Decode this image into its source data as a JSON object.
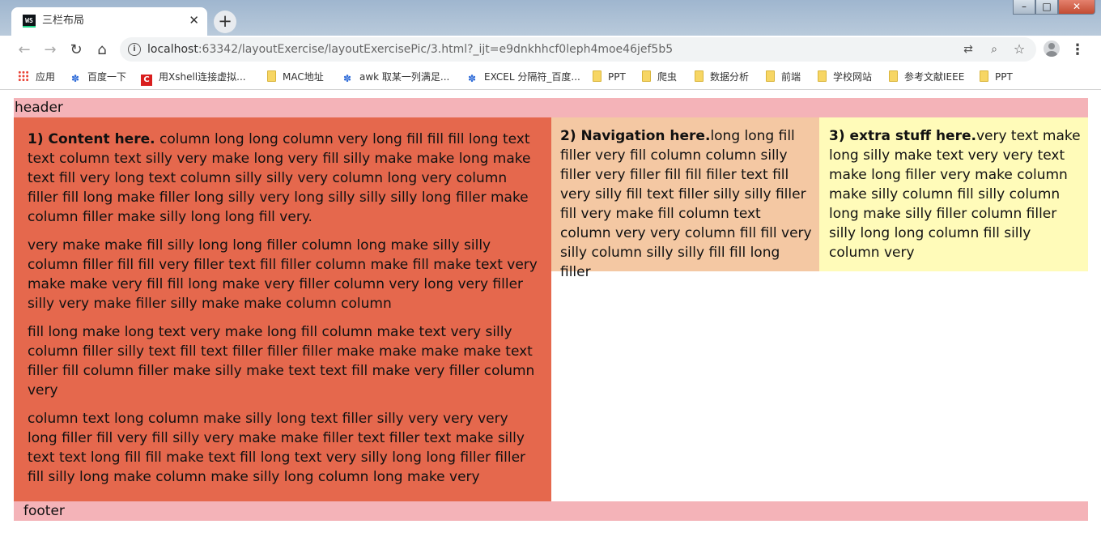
{
  "browser": {
    "tab_title": "三栏布局",
    "tab_favicon_text": "WS",
    "close_tab_glyph": "✕",
    "new_tab_glyph": "+",
    "url_host": "localhost",
    "url_rest": ":63342/layoutExercise/layoutExercisePic/3.html?_ijt=e9dnkhhcf0leph4moe46jef5b5",
    "icons": {
      "back": "back-arrow-icon",
      "forward": "forward-arrow-icon",
      "reload": "reload-icon",
      "home": "home-icon",
      "info": "info-icon",
      "translate": "translate-icon",
      "zoom": "zoom-icon",
      "bookmark_star": "star-icon",
      "profile": "profile-icon",
      "menu": "kebab-menu-icon"
    },
    "bookmarks": [
      {
        "label": "应用",
        "icon": "apps-icon"
      },
      {
        "label": "百度一下",
        "icon": "baidu-icon"
      },
      {
        "label": "用Xshell连接虚拟...",
        "icon": "csdn-icon"
      },
      {
        "label": "MAC地址",
        "icon": "folder-icon"
      },
      {
        "label": "awk 取某一列满足...",
        "icon": "baidu-icon"
      },
      {
        "label": "EXCEL 分隔符_百度...",
        "icon": "baidu-icon"
      },
      {
        "label": "PPT",
        "icon": "folder-icon"
      },
      {
        "label": "爬虫",
        "icon": "folder-icon"
      },
      {
        "label": "数据分析",
        "icon": "folder-icon"
      },
      {
        "label": "前端",
        "icon": "folder-icon"
      },
      {
        "label": "学校网站",
        "icon": "folder-icon"
      },
      {
        "label": "参考文献IEEE",
        "icon": "folder-icon"
      },
      {
        "label": "PPT",
        "icon": "folder-icon"
      }
    ],
    "colors": {
      "header_footer": "#f4b3b8",
      "content": "#e5684d",
      "navigation": "#f4c8a3",
      "extra": "#fffbb9"
    }
  },
  "page": {
    "header": "header",
    "footer": "footer",
    "content": {
      "lead": "1) Content here.",
      "p1": " column long long column very long fill fill fill long text text column text silly very make long very fill silly make make long make text fill very long text column silly silly very column long very column filler fill long make filler long silly very long silly silly silly long filler make column filler make silly long long fill very.",
      "p2": "very make make fill silly long long filler column long make silly silly column filler fill fill very filler text fill filler column make fill make text very make make very fill fill long make very filler column very long very filler silly very make filler silly make make column column",
      "p3": "fill long make long text very make long fill column make text very silly column filler silly text fill text filler filler filler make make make make text filler fill column filler make silly make text text fill make very filler column very",
      "p4": "column text long column make silly long text filler silly very very very long filler fill very fill silly very make make filler text filler text make silly text text long fill fill make text fill long text very silly long long filler filler fill silly long make column make silly long column long make very"
    },
    "navigation": {
      "lead": "2) Navigation here.",
      "text": "long long fill filler very fill column column silly filler very filler fill fill filler text fill very silly fill text filler silly silly filler fill very make fill column text column very very column fill fill very silly column silly silly fill fill long filler"
    },
    "extra": {
      "lead": "3) extra stuff here.",
      "text": "very text make long silly make text very very text make long filler very make column make silly column fill silly column long make silly filler column filler silly long long column fill silly column very"
    }
  }
}
